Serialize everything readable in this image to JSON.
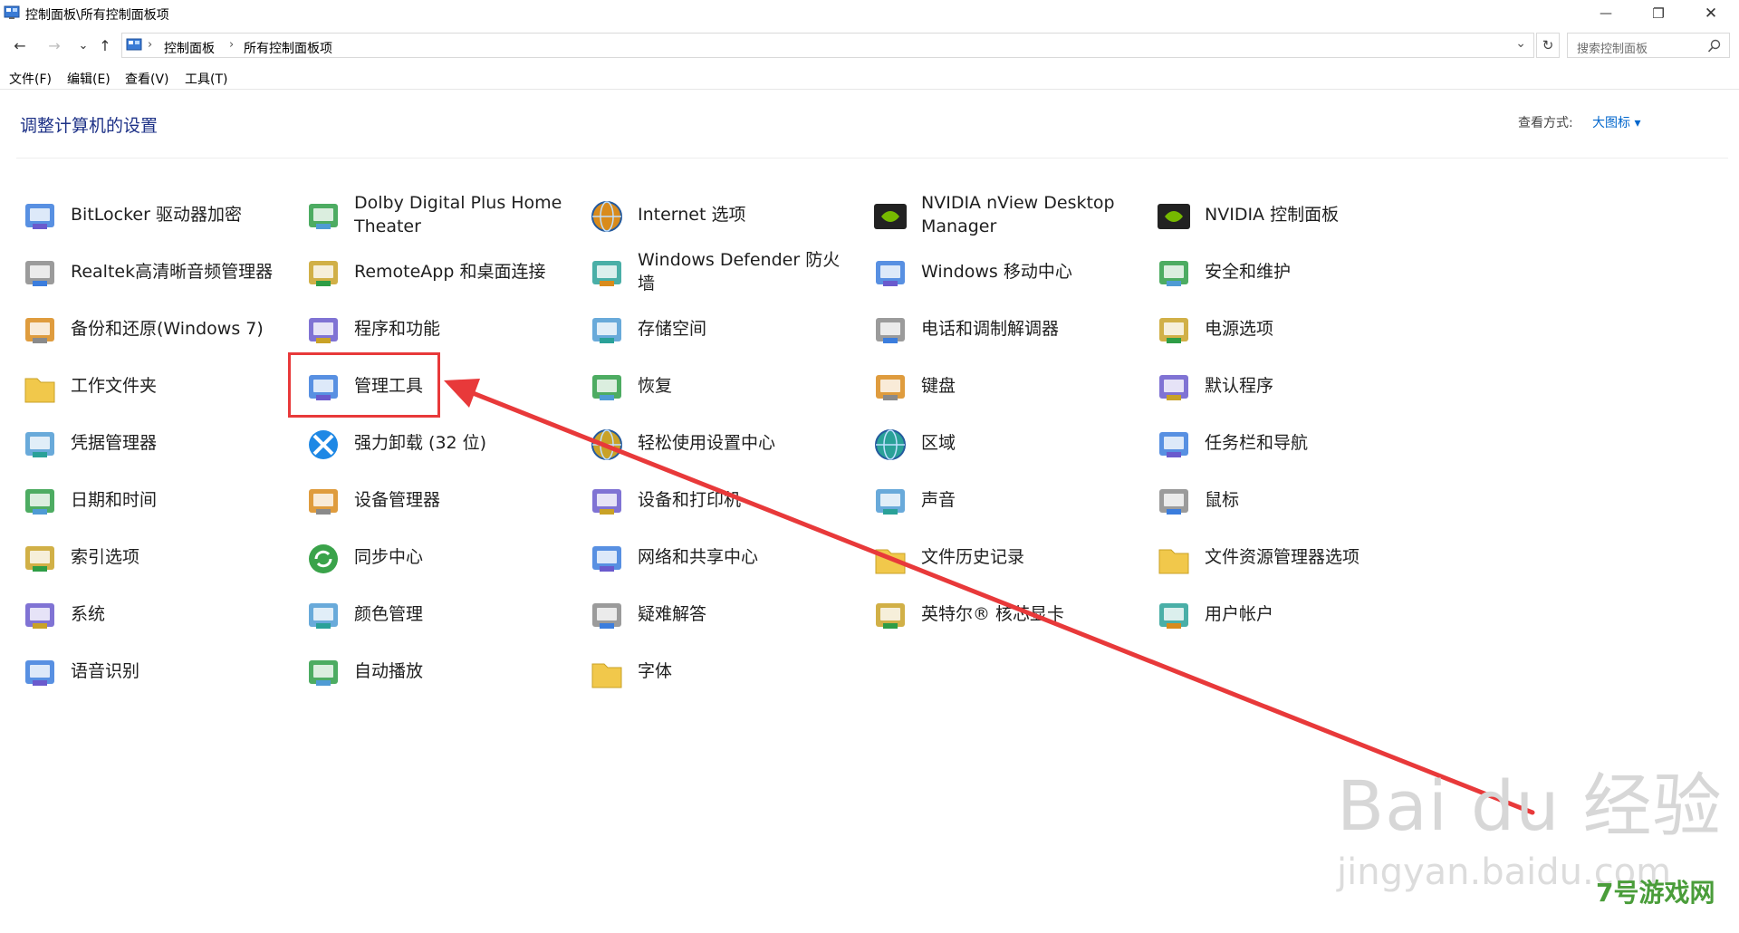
{
  "window": {
    "title": "控制面板\\所有控制面板项",
    "minimize_glyph": "—",
    "maximize_glyph": "❐",
    "close_glyph": "✕"
  },
  "address": {
    "back_glyph": "←",
    "forward_glyph": "→",
    "recent_glyph": "⌄",
    "up_glyph": "↑",
    "crumb_sep_glyph": "›",
    "breadcrumb": [
      "控制面板",
      "所有控制面板项"
    ],
    "dropdown_glyph": "⌄",
    "refresh_glyph": "↻",
    "search_placeholder": "搜索控制面板"
  },
  "menu": [
    "文件(F)",
    "编辑(E)",
    "查看(V)",
    "工具(T)"
  ],
  "main": {
    "heading": "调整计算机的设置",
    "view_by_label": "查看方式:",
    "view_by_value": "大图标 ▾"
  },
  "items": [
    {
      "label": "BitLocker 驱动器加密",
      "icon": "bitlocker-icon"
    },
    {
      "label": "Dolby Digital Plus Home Theater",
      "icon": "dolby-icon"
    },
    {
      "label": "Internet 选项",
      "icon": "internet-options-icon"
    },
    {
      "label": "NVIDIA nView Desktop Manager",
      "icon": "nvidia-nview-icon"
    },
    {
      "label": "NVIDIA 控制面板",
      "icon": "nvidia-control-panel-icon"
    },
    {
      "label": "Realtek高清晰音频管理器",
      "icon": "realtek-audio-icon"
    },
    {
      "label": "RemoteApp 和桌面连接",
      "icon": "remoteapp-icon"
    },
    {
      "label": "Windows Defender 防火墙",
      "icon": "firewall-icon"
    },
    {
      "label": "Windows 移动中心",
      "icon": "mobility-center-icon"
    },
    {
      "label": "安全和维护",
      "icon": "security-flag-icon"
    },
    {
      "label": "备份和还原(Windows 7)",
      "icon": "backup-icon"
    },
    {
      "label": "程序和功能",
      "icon": "programs-icon"
    },
    {
      "label": "存储空间",
      "icon": "storage-spaces-icon"
    },
    {
      "label": "电话和调制解调器",
      "icon": "phone-modem-icon"
    },
    {
      "label": "电源选项",
      "icon": "power-icon"
    },
    {
      "label": "工作文件夹",
      "icon": "work-folders-icon"
    },
    {
      "label": "管理工具",
      "icon": "admin-tools-icon"
    },
    {
      "label": "恢复",
      "icon": "recovery-icon"
    },
    {
      "label": "键盘",
      "icon": "keyboard-icon"
    },
    {
      "label": "默认程序",
      "icon": "default-programs-icon"
    },
    {
      "label": "凭据管理器",
      "icon": "credential-manager-icon"
    },
    {
      "label": "强力卸载 (32 位)",
      "icon": "uninstaller-icon"
    },
    {
      "label": "轻松使用设置中心",
      "icon": "ease-of-access-icon"
    },
    {
      "label": "区域",
      "icon": "region-icon"
    },
    {
      "label": "任务栏和导航",
      "icon": "taskbar-icon"
    },
    {
      "label": "日期和时间",
      "icon": "date-time-icon"
    },
    {
      "label": "设备管理器",
      "icon": "device-manager-icon"
    },
    {
      "label": "设备和打印机",
      "icon": "printer-icon"
    },
    {
      "label": "声音",
      "icon": "sound-icon"
    },
    {
      "label": "鼠标",
      "icon": "mouse-icon"
    },
    {
      "label": "索引选项",
      "icon": "indexing-icon"
    },
    {
      "label": "同步中心",
      "icon": "sync-center-icon"
    },
    {
      "label": "网络和共享中心",
      "icon": "network-icon"
    },
    {
      "label": "文件历史记录",
      "icon": "file-history-icon"
    },
    {
      "label": "文件资源管理器选项",
      "icon": "explorer-options-icon"
    },
    {
      "label": "系统",
      "icon": "system-icon"
    },
    {
      "label": "颜色管理",
      "icon": "color-management-icon"
    },
    {
      "label": "疑难解答",
      "icon": "troubleshooting-icon"
    },
    {
      "label": "英特尔® 核芯显卡",
      "icon": "intel-graphics-icon"
    },
    {
      "label": "用户帐户",
      "icon": "user-accounts-icon"
    },
    {
      "label": "语音识别",
      "icon": "speech-recognition-icon"
    },
    {
      "label": "自动播放",
      "icon": "autoplay-icon"
    },
    {
      "label": "字体",
      "icon": "fonts-icon"
    }
  ],
  "watermark": {
    "line1": "Bai du 经验",
    "line2": "jingyan.baidu.com",
    "badge": "7号游戏网"
  },
  "colors": {
    "heading": "#1e3287",
    "link": "#0066cc",
    "annotation": "#e8393a"
  }
}
